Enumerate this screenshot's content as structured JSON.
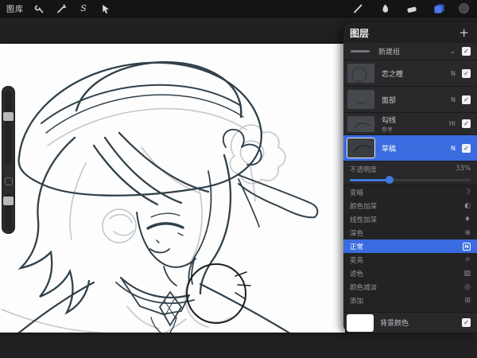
{
  "toolbar": {
    "gallery_label": "图库",
    "left_icons": [
      "actions-wrench",
      "adjustments-wand",
      "selection-s",
      "transform-arrow"
    ],
    "selection_glyph": "S",
    "right_icons": [
      "brush",
      "smudge",
      "eraser",
      "layers",
      "color"
    ]
  },
  "layers_panel": {
    "title": "图层",
    "add_button": "+",
    "group": {
      "name": "新建组",
      "chevron": "⌄"
    },
    "layers": [
      {
        "name": "恋之瞳",
        "blend": "N"
      },
      {
        "name": "面部",
        "blend": "N"
      },
      {
        "name": "勾线",
        "subtitle": "参考",
        "blend": "Hl"
      },
      {
        "name": "草稿",
        "blend": "N",
        "selected": true
      }
    ],
    "opacity": {
      "label": "不透明度",
      "value": "33%",
      "percent": 33
    },
    "blend_modes": [
      {
        "label": "变暗",
        "icon": "☽"
      },
      {
        "label": "颜色加深",
        "icon": "◐"
      },
      {
        "label": "线性加深",
        "icon": "♦"
      },
      {
        "label": "深色",
        "icon": "⊕"
      },
      {
        "label": "正常",
        "icon": "N",
        "selected": true
      },
      {
        "label": "变亮",
        "icon": "☼"
      },
      {
        "label": "滤色",
        "icon": "▨"
      },
      {
        "label": "颜色减淡",
        "icon": "◎"
      },
      {
        "label": "添加",
        "icon": "⊞"
      }
    ],
    "background": {
      "label": "背景颜色"
    },
    "check_glyph": "✓"
  },
  "colors": {
    "accent_blue": "#3a6ce0",
    "slider_blue": "#3f78e0",
    "panel_bg": "#202022",
    "toolbar_bg": "#141416",
    "canvas_white": "#fdfdfd",
    "line_art": "#31414b",
    "sketch_gray": "#c3c7ca"
  }
}
